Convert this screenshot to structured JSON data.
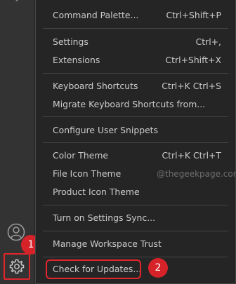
{
  "menu": {
    "items": [
      {
        "label": "Command Palette...",
        "shortcut": "Ctrl+Shift+P"
      },
      {
        "label": "Settings",
        "shortcut": "Ctrl+,"
      },
      {
        "label": "Extensions",
        "shortcut": "Ctrl+Shift+X"
      },
      {
        "label": "Keyboard Shortcuts",
        "shortcut": "Ctrl+K Ctrl+S"
      },
      {
        "label": "Migrate Keyboard Shortcuts from...",
        "shortcut": ""
      },
      {
        "label": "Configure User Snippets",
        "shortcut": ""
      },
      {
        "label": "Color Theme",
        "shortcut": "Ctrl+K Ctrl+T"
      },
      {
        "label": "File Icon Theme",
        "shortcut": ""
      },
      {
        "label": "Product Icon Theme",
        "shortcut": ""
      },
      {
        "label": "Turn on Settings Sync...",
        "shortcut": ""
      },
      {
        "label": "Manage Workspace Trust",
        "shortcut": ""
      },
      {
        "label": "Check for Updates...",
        "shortcut": ""
      }
    ]
  },
  "annotations": {
    "badge_1": "1",
    "badge_2": "2"
  },
  "watermark": "@thegeekpage.com",
  "activity_bar": {
    "icons": [
      "extensions-icon",
      "account-icon",
      "manage-gear-icon"
    ]
  },
  "colors": {
    "menu_background": "#252526",
    "activity_bar_background": "#333333",
    "highlight": "#e0262b"
  }
}
